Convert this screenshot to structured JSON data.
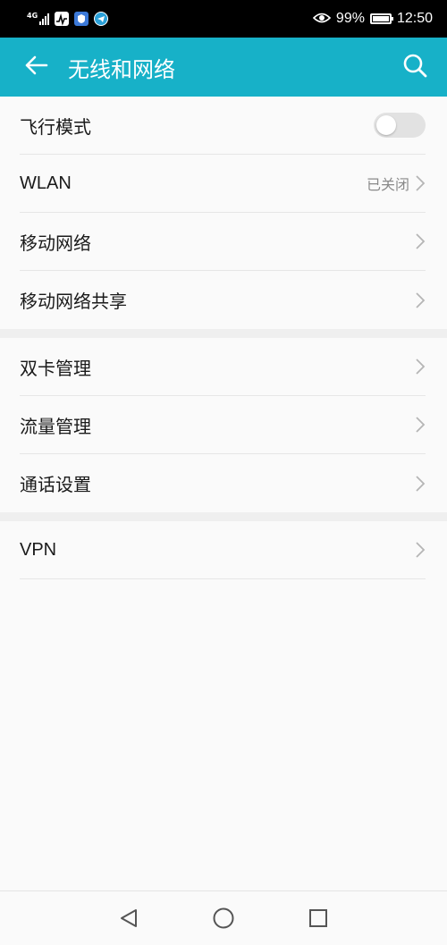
{
  "status_bar": {
    "network": "4G",
    "battery": "99%",
    "time": "12:50",
    "icons": [
      "signal-icon",
      "activity-monitor-app-icon",
      "shield-app-icon",
      "telegram-app-icon",
      "eye-comfort-icon",
      "battery-icon"
    ]
  },
  "header": {
    "title": "无线和网络",
    "back_icon": "arrow-left-icon",
    "search_icon": "search-icon",
    "accent": "#17b1c8"
  },
  "sections": [
    {
      "items": [
        {
          "label": "飞行模式",
          "control": "toggle",
          "on": false
        },
        {
          "label": "WLAN",
          "status": "已关闭",
          "control": "chevron"
        },
        {
          "label": "移动网络",
          "control": "chevron"
        },
        {
          "label": "移动网络共享",
          "control": "chevron"
        }
      ]
    },
    {
      "items": [
        {
          "label": "双卡管理",
          "control": "chevron"
        },
        {
          "label": "流量管理",
          "control": "chevron"
        },
        {
          "label": "通话设置",
          "control": "chevron"
        }
      ]
    },
    {
      "items": [
        {
          "label": "VPN",
          "control": "chevron"
        }
      ]
    }
  ],
  "nav_bar": {
    "buttons": [
      "back-triangle-icon",
      "home-circle-icon",
      "recents-square-icon"
    ]
  }
}
